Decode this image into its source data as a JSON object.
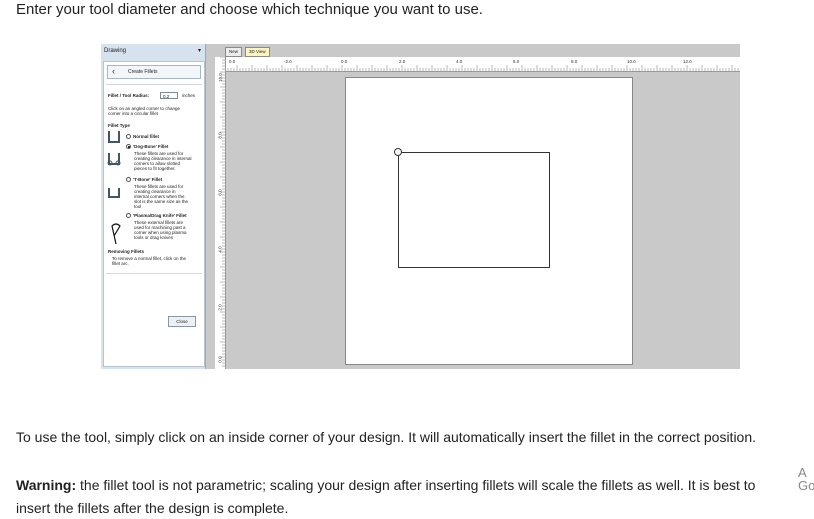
{
  "intro_text": "Enter your tool diameter and choose which technique you want to use.",
  "panel": {
    "title": "Drawing",
    "pin_icon": "pin-icon",
    "back_label": "Create Fillets",
    "radius_label": "Fillet / Tool Radius:",
    "radius_value": "0.2",
    "radius_units": "inches",
    "help_line1": "Click on an angled corner to change",
    "help_line2": "corner into a circular fillet",
    "fillet_type_label": "Fillet Type",
    "normal_label": "Normal fillet",
    "dogbone_label": "'Dog-Bone' Fillet",
    "dogbone_desc": [
      "These fillets are used for",
      "creating clearance in internal",
      "corners to allow slotted",
      "pieces to fit together."
    ],
    "tbone_label": "'T-Bone' Fillet",
    "tbone_desc": [
      "These fillets are used for",
      "creating clearance in",
      "internal corners when the",
      "slot is the same size as the",
      "tool"
    ],
    "plasma_label": "'Plasma/Drag Knife' Fillet",
    "plasma_desc": [
      "These external fillets are",
      "used for machining past a",
      "corner when using plasma",
      "tools or drag knives"
    ],
    "removing_label": "Removing Fillets",
    "removing_desc": [
      "To remove a normal fillet, click on the",
      "fillet arc."
    ],
    "close_label": "Close",
    "selected_type": "dog-bone"
  },
  "view": {
    "tabs": [
      "New",
      "3D View"
    ],
    "active_tab": "3D View",
    "ruler_top": [
      "0.0",
      "-2.0",
      "0.0",
      "2.0",
      "4.0",
      "6.0",
      "8.0",
      "10.0",
      "12.0"
    ],
    "ruler_left": [
      "10.0",
      "8.0",
      "6.0",
      "4.0",
      "2.0",
      "0.0"
    ]
  },
  "para1": "To use the tool, simply click on an inside corner of your design. It will automatically insert the fillet in the correct position.",
  "warning_label": "Warning:",
  "warning_text": " the fillet tool is not parametric; scaling your design after inserting fillets will scale the fillets as well. It is best to",
  "warning_text2": "insert the fillets after the design is complete.",
  "ad_chars": [
    "A",
    "Go"
  ],
  "colors": {
    "panel_bg": "#d6e2ee",
    "workspace_bg": "#c9c9c9",
    "active_tab": "#fdf5c0"
  }
}
